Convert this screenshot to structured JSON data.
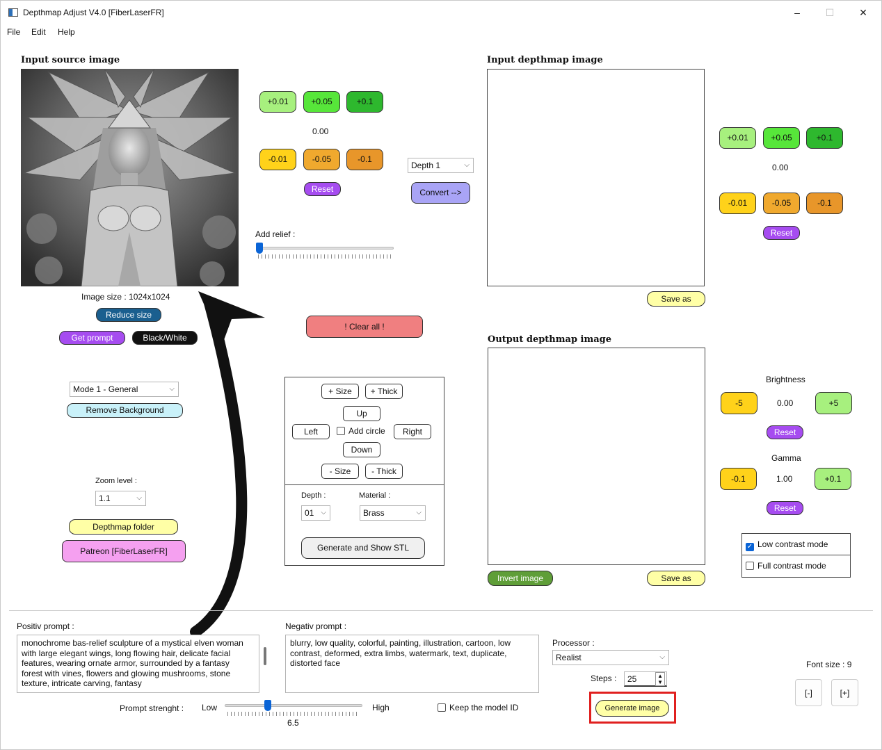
{
  "window": {
    "title": "Depthmap Adjust V4.0 [FiberLaserFR]",
    "controls": {
      "minimize": "–",
      "maximize": "☐",
      "close": "✕"
    }
  },
  "menu": [
    "File",
    "Edit",
    "Help"
  ],
  "left": {
    "input_label": "Input source image",
    "image_size": "Image size : 1024x1024",
    "reduce_size": "Reduce size",
    "get_prompt": "Get prompt",
    "black_white": "Black/White",
    "mode_value": "Mode 1 - General",
    "remove_background": "Remove Background",
    "zoom_label": "Zoom level :",
    "zoom_value": "1.1",
    "depthmap_folder": "Depthmap folder",
    "patreon": "Patreon [FiberLaserFR]"
  },
  "adjust_top": {
    "plus_001": "+0.01",
    "plus_005": "+0.05",
    "plus_01": "+0.1",
    "value": "0.00",
    "minus_001": "-0.01",
    "minus_005": "-0.05",
    "minus_01": "-0.1",
    "reset": "Reset",
    "add_relief": "Add relief :",
    "relief_value": 0
  },
  "depth_combo": "Depth 1",
  "convert": "Convert -->",
  "clear_all": "!   Clear all   !",
  "shape_panel": {
    "plus_size": "+ Size",
    "plus_thick": "+ Thick",
    "up": "Up",
    "left": "Left",
    "add_circle": "Add circle",
    "right": "Right",
    "down": "Down",
    "minus_size": "- Size",
    "minus_thick": "- Thick",
    "depth_label": "Depth :",
    "depth_value": "01",
    "material_label": "Material :",
    "material_value": "Brass",
    "generate_stl": "Generate and Show STL"
  },
  "input_depthmap": {
    "label": "Input depthmap image",
    "save_as": "Save as",
    "plus_001": "+0.01",
    "plus_005": "+0.05",
    "plus_01": "+0.1",
    "value": "0.00",
    "minus_001": "-0.01",
    "minus_005": "-0.05",
    "minus_01": "-0.1",
    "reset": "Reset"
  },
  "output_depthmap": {
    "label": "Output depthmap image",
    "invert": "Invert image",
    "save_as": "Save as",
    "brightness_label": "Brightness",
    "brightness_minus": "-5",
    "brightness_value": "0.00",
    "brightness_plus": "+5",
    "brightness_reset": "Reset",
    "gamma_label": "Gamma",
    "gamma_minus": "-0.1",
    "gamma_value": "1.00",
    "gamma_plus": "+0.1",
    "gamma_reset": "Reset",
    "low_contrast": "Low contrast mode",
    "full_contrast": "Full contrast mode"
  },
  "prompts": {
    "positive_label": "Positiv prompt :",
    "positive_text": "monochrome bas-relief sculpture of a mystical elven woman with large elegant wings, long flowing hair, delicate facial features, wearing ornate armor, surrounded by a fantasy forest with vines, flowers and glowing mushrooms, stone texture, intricate carving, fantasy",
    "negative_label": "Negativ prompt :",
    "negative_text": "blurry, low quality, colorful, painting, illustration, cartoon, low contrast, deformed, extra limbs, watermark, text, duplicate, distorted face",
    "strength_label": "Prompt strenght :",
    "low": "Low",
    "high": "High",
    "strength_value": "6.5",
    "keep_model": "Keep the model ID"
  },
  "processor": {
    "label": "Processor :",
    "value": "Realist",
    "steps_label": "Steps :",
    "steps_value": "25",
    "generate": "Generate image"
  },
  "font": {
    "label": "Font size : 9",
    "minus": "[-]",
    "plus": "[+]"
  },
  "colors": {
    "light_green": "#a7f07e",
    "green": "#57e63a",
    "dark_green": "#2eb82e",
    "yellow": "#ffd21a",
    "orange": "#f0a92e",
    "dark_orange": "#e8962a",
    "purple": "#a64cf0",
    "blue_button": "#1a5f8f",
    "convert": "#a9a4f6",
    "clear_all": "#f07f80",
    "light_yellow": "#ffffa6",
    "pink": "#f5a0f0",
    "light_cyan": "#c9f1f9",
    "invert_green": "#5f9e38",
    "highlight_red": "#e0201f"
  }
}
